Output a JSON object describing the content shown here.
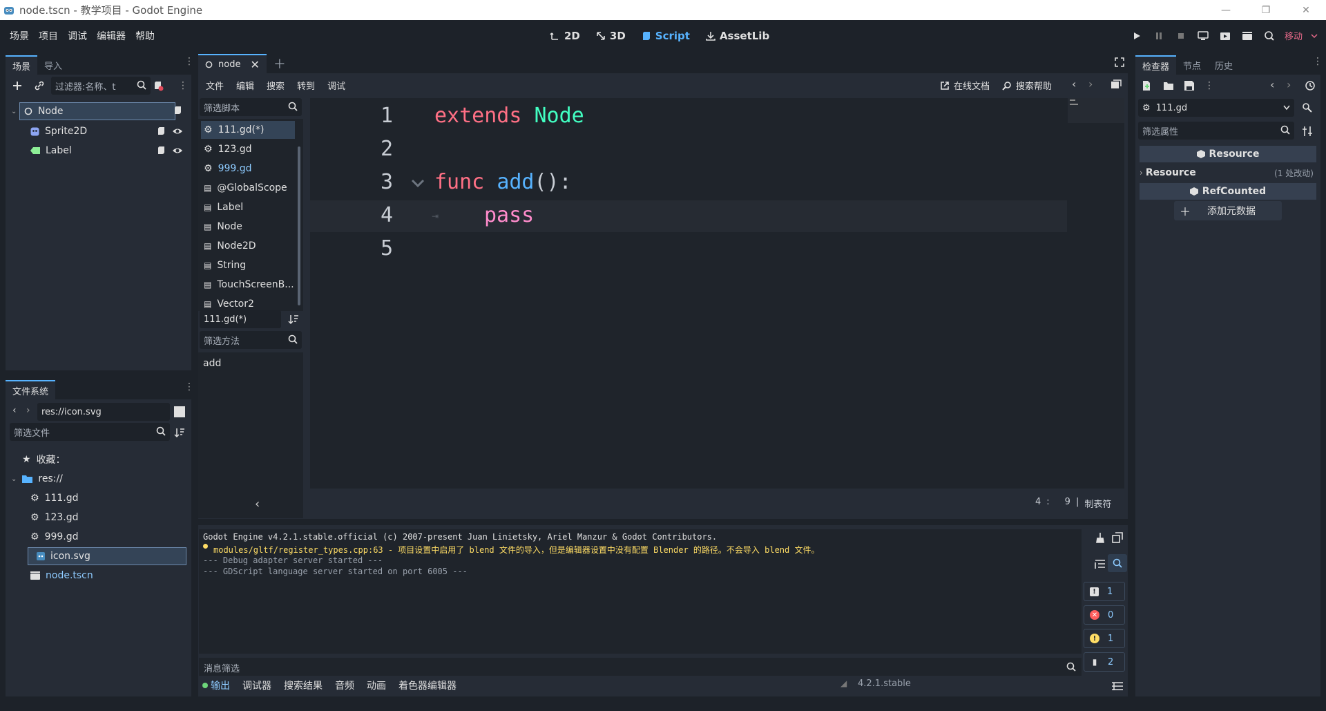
{
  "window": {
    "title": "node.tscn - 教学项目 - Godot Engine",
    "minimize": "—",
    "maximize": "❐",
    "close": "✕"
  },
  "menu": {
    "items": [
      "场景",
      "项目",
      "调试",
      "编辑器",
      "帮助"
    ]
  },
  "workspaces": {
    "items": [
      {
        "label": "2D",
        "active": false
      },
      {
        "label": "3D",
        "active": false
      },
      {
        "label": "Script",
        "active": true
      },
      {
        "label": "AssetLib",
        "active": false
      }
    ]
  },
  "run_bar": {
    "renderer": "移动"
  },
  "scene_dock": {
    "tabs": [
      "场景",
      "导入"
    ],
    "filter_placeholder": "过滤器:名称、t",
    "tree": [
      {
        "name": "Node",
        "type": "node",
        "selected": true
      },
      {
        "name": "Sprite2D",
        "type": "sprite",
        "selected": false
      },
      {
        "name": "Label",
        "type": "label",
        "selected": false
      }
    ]
  },
  "filesystem_dock": {
    "title": "文件系统",
    "path": "res://icon.svg",
    "filter_placeholder": "筛选文件",
    "favorites": "收藏：",
    "root": "res://",
    "files": [
      {
        "name": "111.gd",
        "kind": "script",
        "selected": false
      },
      {
        "name": "123.gd",
        "kind": "script",
        "selected": false
      },
      {
        "name": "999.gd",
        "kind": "script",
        "selected": false
      },
      {
        "name": "icon.svg",
        "kind": "image",
        "selected": true
      },
      {
        "name": "node.tscn",
        "kind": "scene",
        "selected": false
      }
    ]
  },
  "editor": {
    "tab": "node",
    "script_menu": [
      "文件",
      "编辑",
      "搜索",
      "转到",
      "调试"
    ],
    "online_docs": "在线文档",
    "search_help": "搜索帮助",
    "filter_scripts": "筛选脚本",
    "scripts": [
      {
        "name": "111.gd(*)",
        "kind": "script",
        "selected": true,
        "color": "#e0e0e0"
      },
      {
        "name": "123.gd",
        "kind": "script",
        "selected": false,
        "color": "#e0e0e0"
      },
      {
        "name": "999.gd",
        "kind": "script",
        "selected": false,
        "color": "#8ecbff"
      },
      {
        "name": "@GlobalScope",
        "kind": "doc",
        "selected": false,
        "color": "#e0e0e0"
      },
      {
        "name": "Label",
        "kind": "doc",
        "selected": false,
        "color": "#e0e0e0"
      },
      {
        "name": "Node",
        "kind": "doc",
        "selected": false,
        "color": "#e0e0e0"
      },
      {
        "name": "Node2D",
        "kind": "doc",
        "selected": false,
        "color": "#e0e0e0"
      },
      {
        "name": "String",
        "kind": "doc",
        "selected": false,
        "color": "#e0e0e0"
      },
      {
        "name": "TouchScreenB...",
        "kind": "doc",
        "selected": false,
        "color": "#e0e0e0"
      },
      {
        "name": "Vector2",
        "kind": "doc",
        "selected": false,
        "color": "#e0e0e0"
      }
    ],
    "current_script": "111.gd(*)",
    "filter_methods": "筛选方法",
    "methods": [
      "add"
    ],
    "line_numbers": [
      "1",
      "2",
      "3",
      "4",
      "5"
    ],
    "code": {
      "l1_kw": "extends",
      "l1_type": "Node",
      "l3_kw": "func",
      "l3_fn": "add",
      "l3_rest": "():",
      "l4_kw": "pass"
    },
    "status_line": "4",
    "status_sep": ":",
    "status_col": "9",
    "status_bar": "|",
    "indent_mode": "制表符"
  },
  "output": {
    "lines": [
      {
        "text": "Godot Engine v4.2.1.stable.official (c) 2007-present Juan Linietsky, Ariel Manzur & Godot Contributors.",
        "color": "#e0e0e0"
      },
      {
        "text": "modules/gltf/register_types.cpp:63 - 项目设置中启用了 blend 文件的导入，但是编辑器设置中没有配置 Blender 的路径。不会导入 blend 文件。",
        "color": "#ffdd65"
      },
      {
        "text": "--- Debug adapter server started ---",
        "color": "#9aa2ad"
      },
      {
        "text": "--- GDScript language server started on port 6005 ---",
        "color": "#9aa2ad"
      }
    ],
    "filter_placeholder": "消息筛选",
    "counts": {
      "messages": "1",
      "errors": "0",
      "warnings": "1",
      "editor": "2"
    },
    "bottom_tabs": [
      "输出",
      "调试器",
      "搜索结果",
      "音频",
      "动画",
      "着色器编辑器"
    ],
    "version": "4.2.1.stable"
  },
  "inspector": {
    "tabs": [
      "检查器",
      "节点",
      "历史"
    ],
    "resource_name": "111.gd",
    "filter_placeholder": "筛选属性",
    "section_resource": "Resource",
    "row_resource": "Resource",
    "row_changes": "(1 处改动)",
    "section_refcounted": "RefCounted",
    "add_metadata": "添加元数据"
  }
}
